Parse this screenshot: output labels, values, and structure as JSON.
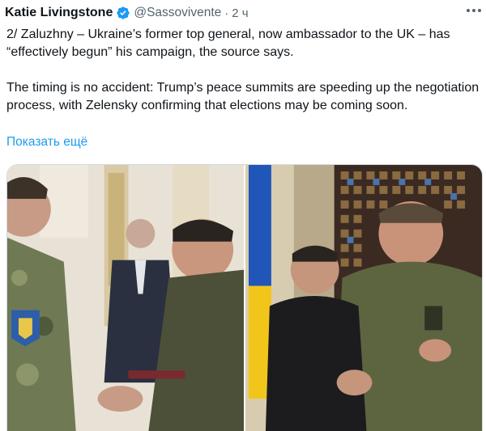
{
  "tweet": {
    "author_name": "Katie Livingstone",
    "handle": "@Sassovivente",
    "separator": "·",
    "time": "2 ч",
    "verified_icon": "verified-badge-icon",
    "more_icon": "more-options-icon",
    "paragraphs": [
      "2/ Zaluzhny – Ukraine’s former top general, now ambassador to the UK – has “effectively begun” his campaign, the source says.",
      "The timing is no accident: Trump’s peace summits are speeding up the negotiation process, with Zelensky confirming that elections may be coming soon."
    ],
    "show_more": "Показать ещё"
  },
  "colors": {
    "text": "#0f1419",
    "secondary": "#536471",
    "link": "#1d9bf0",
    "verified": "#1d9bf0"
  }
}
